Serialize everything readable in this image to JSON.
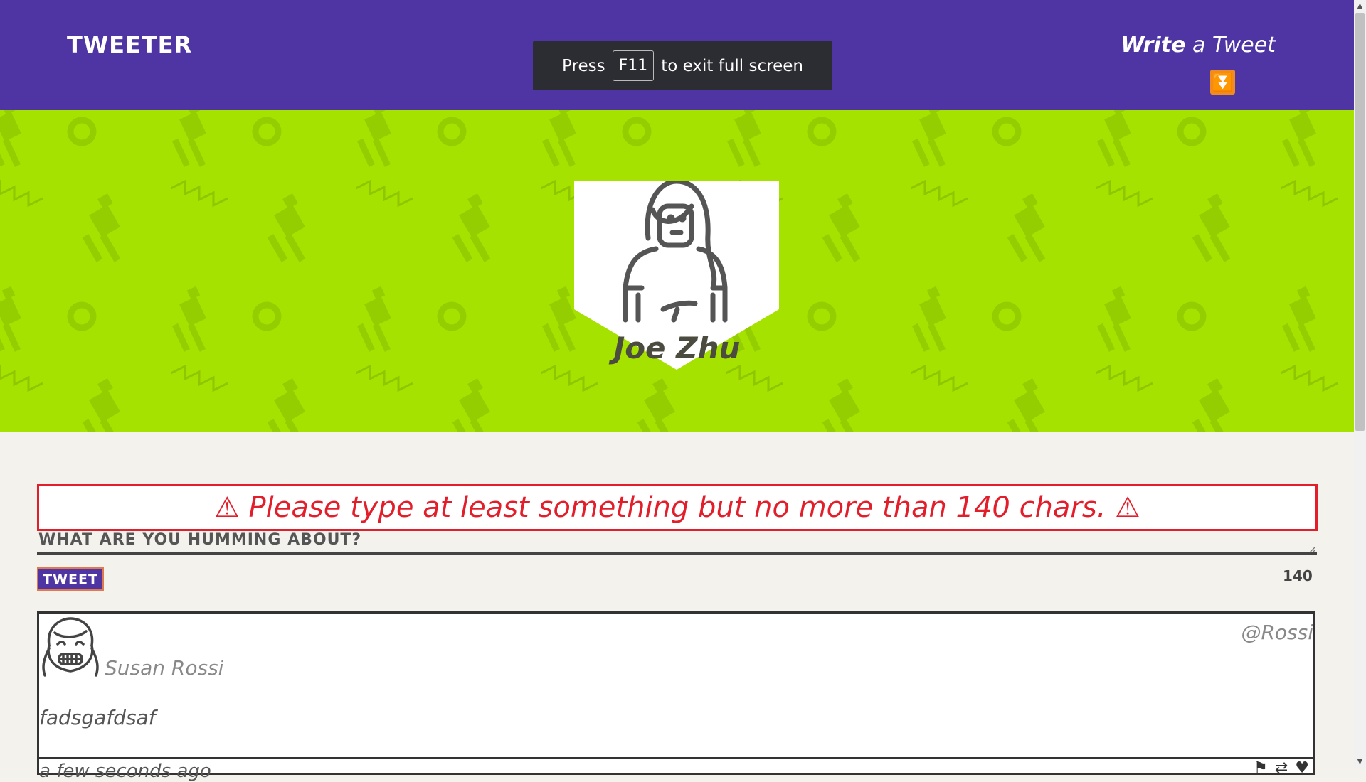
{
  "app": {
    "logo": "TWEETER"
  },
  "header": {
    "write_strong": "Write",
    "write_rest": " a Tweet",
    "write_icon": "double-down-arrow-icon",
    "accent_color": "#f28b1e"
  },
  "fullscreen_toast": {
    "prefix": "Press",
    "key": "F11",
    "suffix": "to exit full screen"
  },
  "profile": {
    "name": "Joe Zhu",
    "banner_color": "#a5e200"
  },
  "form": {
    "warning": "⚠ Please type at least something but no more than 140 chars. ⚠",
    "label": "WHAT ARE YOU HUMMING ABOUT?",
    "button": "TWEET",
    "char_count": "140"
  },
  "tweet": {
    "name": "Susan Rossi",
    "handle": "@Rossi",
    "text": "fadsgafdsaf",
    "footer": "a few seconds ago",
    "actions": [
      "flag-icon",
      "retweet-icon",
      "heart-icon"
    ]
  },
  "colors": {
    "header": "#4f35a3",
    "warning": "#e31e2b",
    "page": "#f4f2ed"
  }
}
